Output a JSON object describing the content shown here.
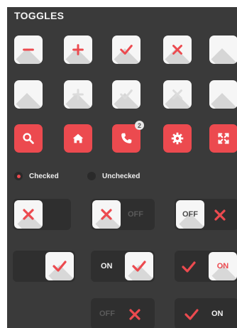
{
  "section_title": "TOGGLES",
  "colors": {
    "accent": "#ec4a4f",
    "panel": "#3a3a3a",
    "tile": "#f6f6f6",
    "track": "#2f2f2f",
    "muted_text": "#5a5a5a"
  },
  "icon_rows": [
    [
      "minus-icon",
      "plus-icon",
      "check-icon",
      "x-icon",
      "blank-icon"
    ],
    [
      "blank-icon",
      "plus-icon",
      "check-icon",
      "x-icon",
      "blank-icon"
    ],
    [
      "search-icon",
      "home-icon",
      "phone-icon",
      "gear-icon",
      "expand-icon"
    ]
  ],
  "phone_badge": "2",
  "radios": [
    {
      "label": "Checked",
      "checked": true
    },
    {
      "label": "Unchecked",
      "checked": false
    }
  ],
  "switches": [
    {
      "knob_icon": "x-icon",
      "knob_text": "",
      "knob_side": "left",
      "outside_text": "",
      "outside_icon": "",
      "outside_text_muted": false
    },
    {
      "knob_icon": "x-icon",
      "knob_text": "",
      "knob_side": "left",
      "outside_text": "OFF",
      "outside_icon": "",
      "outside_text_muted": true
    },
    {
      "knob_icon": "",
      "knob_text": "OFF",
      "knob_side": "left",
      "outside_text": "",
      "outside_icon": "x-icon",
      "outside_text_muted": false
    },
    {
      "knob_icon": "check-icon",
      "knob_text": "",
      "knob_side": "right",
      "outside_text": "",
      "outside_icon": "",
      "outside_text_muted": false
    },
    {
      "knob_icon": "check-icon",
      "knob_text": "",
      "knob_side": "right",
      "outside_text": "ON",
      "outside_icon": "",
      "outside_text_muted": false
    },
    {
      "knob_icon": "",
      "knob_text": "ON",
      "knob_side": "right",
      "outside_text": "",
      "outside_icon": "check-icon",
      "outside_text_muted": false
    },
    {
      "knob_icon": "",
      "knob_text": "",
      "knob_side": "none",
      "outside_text": "OFF",
      "outside_icon": "x-icon",
      "outside_text_muted": true
    },
    {
      "knob_icon": "",
      "knob_text": "",
      "knob_side": "none",
      "outside_text": "ON",
      "outside_icon": "check-icon",
      "outside_text_muted": false
    }
  ]
}
